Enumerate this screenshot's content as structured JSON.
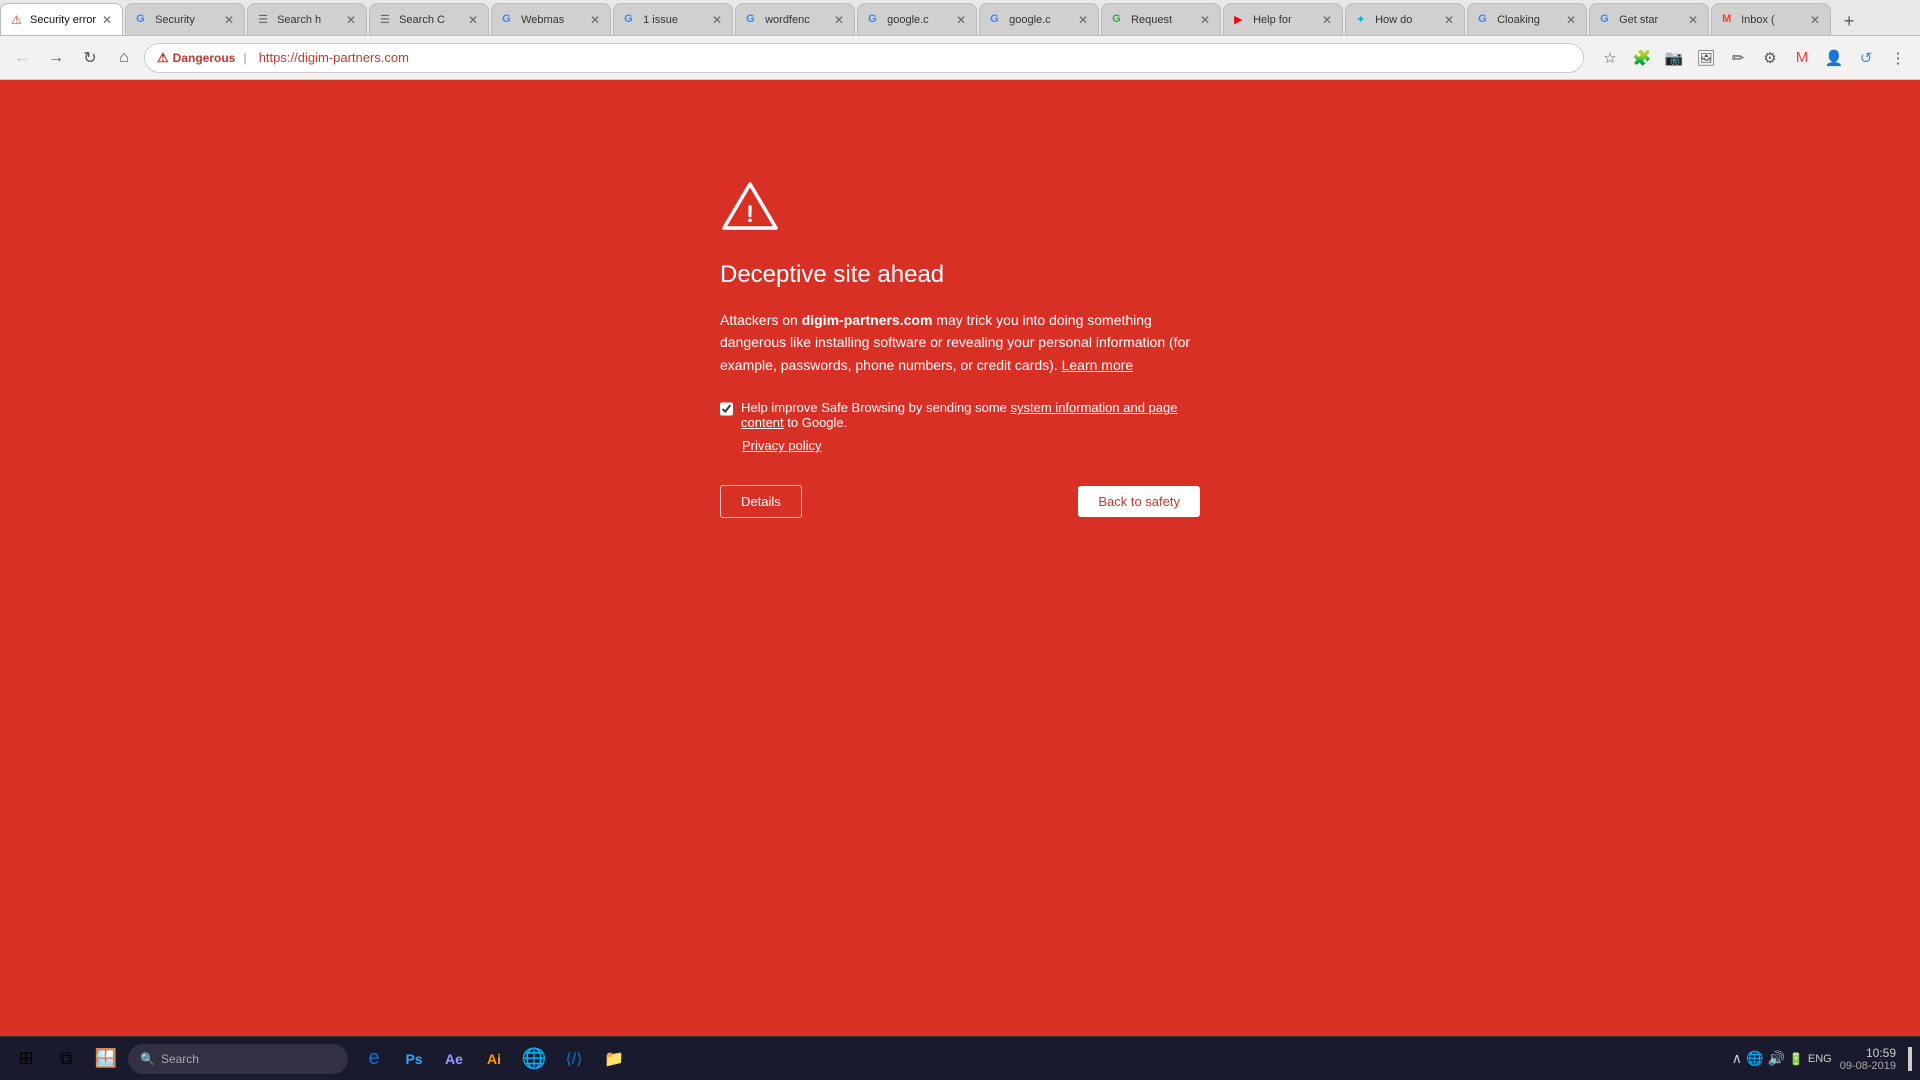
{
  "browser": {
    "tabs": [
      {
        "id": "tab-security-error",
        "label": "Security error",
        "favicon": "⚠",
        "favicon_color": "#c0392b",
        "active": true,
        "closeable": true
      },
      {
        "id": "tab-security",
        "label": "Security",
        "favicon": "G",
        "favicon_color": "#4285f4",
        "active": false,
        "closeable": true
      },
      {
        "id": "tab-search-h",
        "label": "Search h",
        "favicon": "☰",
        "favicon_color": "#666",
        "active": false,
        "closeable": true
      },
      {
        "id": "tab-search-c",
        "label": "Search C",
        "favicon": "☰",
        "favicon_color": "#666",
        "active": false,
        "closeable": true
      },
      {
        "id": "tab-webmaster",
        "label": "Webmas",
        "favicon": "G",
        "favicon_color": "#4285f4",
        "active": false,
        "closeable": true
      },
      {
        "id": "tab-1issue",
        "label": "1 issue",
        "favicon": "G",
        "favicon_color": "#4285f4",
        "active": false,
        "closeable": true
      },
      {
        "id": "tab-wordfence",
        "label": "wordfenc",
        "favicon": "G",
        "favicon_color": "#4285f4",
        "active": false,
        "closeable": true
      },
      {
        "id": "tab-google1",
        "label": "google.c",
        "favicon": "G",
        "favicon_color": "#4285f4",
        "active": false,
        "closeable": true
      },
      {
        "id": "tab-google2",
        "label": "google.c",
        "favicon": "G",
        "favicon_color": "#4285f4",
        "active": false,
        "closeable": true
      },
      {
        "id": "tab-request",
        "label": "Request",
        "favicon": "G",
        "favicon_color": "#34a853",
        "active": false,
        "closeable": true
      },
      {
        "id": "tab-help-yt",
        "label": "Help for",
        "favicon": "▶",
        "favicon_color": "#ff0000",
        "active": false,
        "closeable": true
      },
      {
        "id": "tab-how-do",
        "label": "How do",
        "favicon": "✦",
        "favicon_color": "#00b4d8",
        "active": false,
        "closeable": true
      },
      {
        "id": "tab-cloaking",
        "label": "Cloaking",
        "favicon": "G",
        "favicon_color": "#4285f4",
        "active": false,
        "closeable": true
      },
      {
        "id": "tab-get-start",
        "label": "Get star",
        "favicon": "G",
        "favicon_color": "#4285f4",
        "active": false,
        "closeable": true
      },
      {
        "id": "tab-inbox",
        "label": "Inbox (",
        "favicon": "M",
        "favicon_color": "#ea4335",
        "active": false,
        "closeable": true
      }
    ],
    "address": "https://digim-partners.com",
    "danger_label": "Dangerous"
  },
  "warning_page": {
    "title": "Deceptive site ahead",
    "description_prefix": "Attackers on ",
    "site_name": "digim-partners.com",
    "description_suffix": " may trick you into doing something dangerous like installing software or revealing your personal information (for example, passwords, phone numbers, or credit cards).",
    "learn_more_label": "Learn more",
    "checkbox_label": "Help improve Safe Browsing by sending some ",
    "checkbox_link_label": "system information and page content",
    "checkbox_suffix": " to Google.",
    "privacy_policy_label": "Privacy policy",
    "details_button": "Details",
    "back_button": "Back to safety"
  },
  "taskbar": {
    "search_placeholder": "Search",
    "time": "10:59",
    "date": "09-08-2019",
    "language": "ENG"
  }
}
